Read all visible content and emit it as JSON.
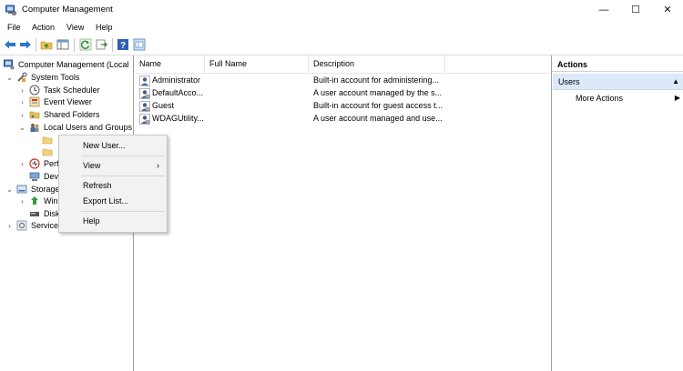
{
  "window": {
    "title": "Computer Management",
    "controls": {
      "minimize": "—",
      "maximize": "☐",
      "close": "✕"
    }
  },
  "menubar": {
    "items": [
      "File",
      "Action",
      "View",
      "Help"
    ]
  },
  "toolbar": {
    "icons": [
      "back-icon",
      "forward-icon",
      "up-folder-icon",
      "show-tree-icon",
      "refresh-icon",
      "export-icon",
      "help-icon",
      "console-tree-icon"
    ]
  },
  "tree": {
    "root": "Computer Management (Local",
    "system_tools": "System Tools",
    "task_scheduler": "Task Scheduler",
    "event_viewer": "Event Viewer",
    "shared_folders": "Shared Folders",
    "local_users": "Local Users and Groups",
    "performance": "Perf",
    "device_manager": "Dev",
    "storage": "Storage",
    "windows_backup": "Win",
    "disk_management": "Disk",
    "services": "Service"
  },
  "list": {
    "columns": [
      "Name",
      "Full Name",
      "Description"
    ],
    "rows": [
      {
        "name": "Administrator",
        "full_name": "",
        "description": "Built-in account for administering..."
      },
      {
        "name": "DefaultAcco...",
        "full_name": "",
        "description": "A user account managed by the s..."
      },
      {
        "name": "Guest",
        "full_name": "",
        "description": "Built-in account for guest access t..."
      },
      {
        "name": "WDAGUtility...",
        "full_name": "",
        "description": "A user account managed and use..."
      }
    ]
  },
  "actions": {
    "title": "Actions",
    "section": "Users",
    "section_arrow": "▲",
    "more_actions": "More Actions",
    "more_arrow": "▶"
  },
  "context_menu": {
    "new_user": "New User...",
    "view": "View",
    "view_arrow": "›",
    "refresh": "Refresh",
    "export_list": "Export List...",
    "help": "Help"
  },
  "colors": {
    "selection": "#dbe9f9",
    "menu_bg": "#f2f2f2"
  }
}
